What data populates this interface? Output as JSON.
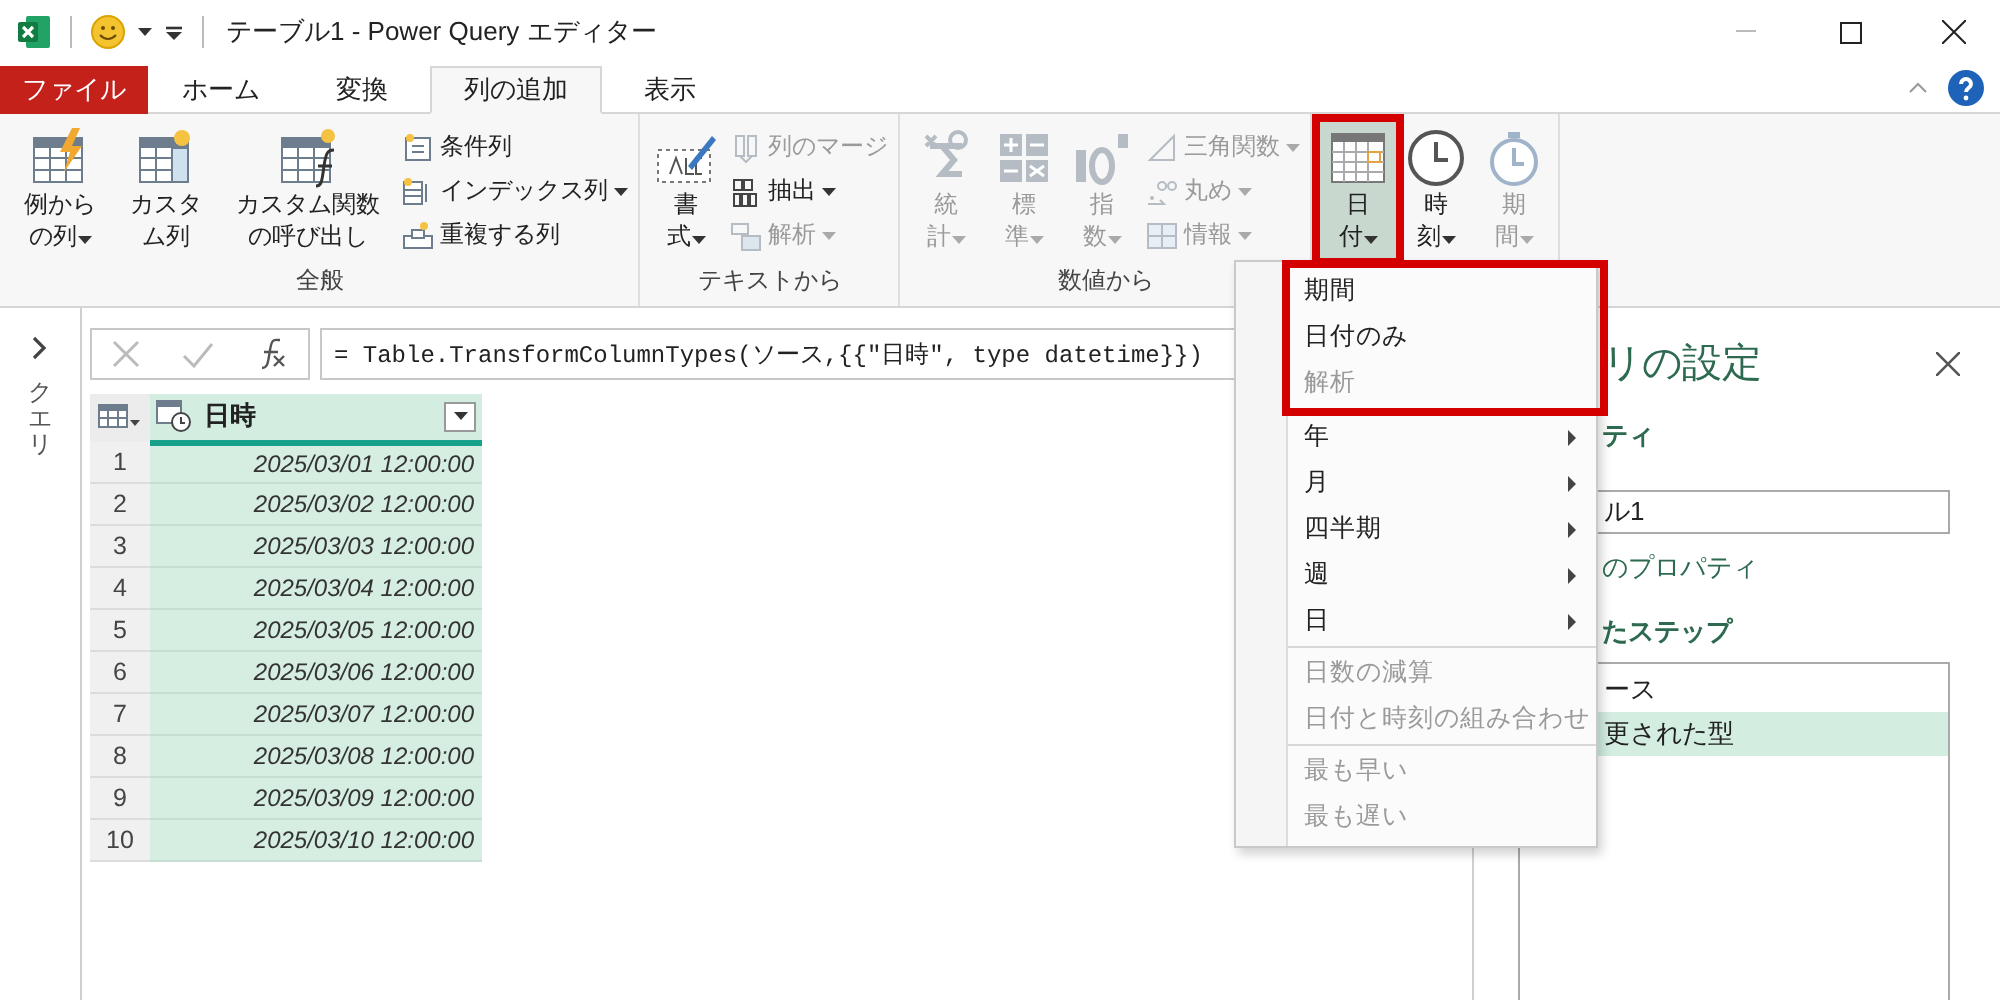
{
  "window": {
    "title": "テーブル1 - Power Query エディター"
  },
  "tabs": [
    {
      "label": "ファイル",
      "kind": "file",
      "selected": false
    },
    {
      "label": "ホーム",
      "kind": "tab",
      "selected": false
    },
    {
      "label": "変換",
      "kind": "tab",
      "selected": false
    },
    {
      "label": "列の追加",
      "kind": "tab",
      "selected": true
    },
    {
      "label": "表示",
      "kind": "tab",
      "selected": false
    }
  ],
  "ribbon": {
    "groups": [
      {
        "label": "全般",
        "large": [
          {
            "label": "例からの列",
            "dropdown": true,
            "disabled": false,
            "highlighted": false
          },
          {
            "label": "カスタム列",
            "dropdown": false,
            "disabled": false,
            "highlighted": false
          },
          {
            "label": "カスタム関数の呼び出し",
            "dropdown": false,
            "disabled": false,
            "highlighted": false
          }
        ],
        "small": [
          {
            "label": "条件列",
            "dropdown": false,
            "disabled": false
          },
          {
            "label": "インデックス列",
            "dropdown": true,
            "disabled": false
          },
          {
            "label": "重複する列",
            "dropdown": false,
            "disabled": false
          }
        ]
      },
      {
        "label": "テキストから",
        "large": [
          {
            "label": "書式",
            "dropdown": true,
            "disabled": false,
            "highlighted": false
          }
        ],
        "small": [
          {
            "label": "列のマージ",
            "dropdown": false,
            "disabled": true
          },
          {
            "label": "抽出",
            "dropdown": true,
            "disabled": false
          },
          {
            "label": "解析",
            "dropdown": true,
            "disabled": true
          }
        ]
      },
      {
        "label": "数値から",
        "large": [
          {
            "label": "統計",
            "dropdown": true,
            "disabled": true,
            "highlighted": false
          },
          {
            "label": "標準",
            "dropdown": true,
            "disabled": true,
            "highlighted": false
          },
          {
            "label": "指数",
            "dropdown": true,
            "disabled": true,
            "highlighted": false
          }
        ],
        "small": [
          {
            "label": "三角関数",
            "dropdown": true,
            "disabled": true
          },
          {
            "label": "丸め",
            "dropdown": true,
            "disabled": true
          },
          {
            "label": "情報",
            "dropdown": true,
            "disabled": true
          }
        ]
      },
      {
        "large": [
          {
            "label": "日付",
            "dropdown": true,
            "disabled": false,
            "highlighted": true
          },
          {
            "label": "時刻",
            "dropdown": true,
            "disabled": false,
            "highlighted": false
          },
          {
            "label": "期間",
            "dropdown": true,
            "disabled": true,
            "highlighted": false
          }
        ]
      }
    ]
  },
  "queries_pane": {
    "label": "クエリ"
  },
  "formula_bar": {
    "formula": "= Table.TransformColumnTypes(ソース,{{\"日時\", type datetime}})"
  },
  "table": {
    "columns": [
      {
        "label": "日時",
        "selected": true
      }
    ],
    "rows": [
      {
        "number": "1",
        "cells": [
          "2025/03/01 12:00:00"
        ]
      },
      {
        "number": "2",
        "cells": [
          "2025/03/02 12:00:00"
        ]
      },
      {
        "number": "3",
        "cells": [
          "2025/03/03 12:00:00"
        ]
      },
      {
        "number": "4",
        "cells": [
          "2025/03/04 12:00:00"
        ]
      },
      {
        "number": "5",
        "cells": [
          "2025/03/05 12:00:00"
        ]
      },
      {
        "number": "6",
        "cells": [
          "2025/03/06 12:00:00"
        ]
      },
      {
        "number": "7",
        "cells": [
          "2025/03/07 12:00:00"
        ]
      },
      {
        "number": "8",
        "cells": [
          "2025/03/08 12:00:00"
        ]
      },
      {
        "number": "9",
        "cells": [
          "2025/03/09 12:00:00"
        ]
      },
      {
        "number": "10",
        "cells": [
          "2025/03/10 12:00:00"
        ]
      }
    ]
  },
  "menu": {
    "sections": [
      {
        "highlighted": true,
        "items": [
          {
            "label": "期間",
            "disabled": false,
            "submenu": false
          },
          {
            "label": "日付のみ",
            "disabled": false,
            "submenu": false
          },
          {
            "label": "解析",
            "disabled": true,
            "submenu": false
          }
        ]
      },
      {
        "highlighted": false,
        "items": [
          {
            "label": "年",
            "disabled": false,
            "submenu": true
          },
          {
            "label": "月",
            "disabled": false,
            "submenu": true
          },
          {
            "label": "四半期",
            "disabled": false,
            "submenu": true
          },
          {
            "label": "週",
            "disabled": false,
            "submenu": true
          },
          {
            "label": "日",
            "disabled": false,
            "submenu": true
          }
        ]
      },
      {
        "highlighted": false,
        "items": [
          {
            "label": "日数の減算",
            "disabled": true,
            "submenu": false
          },
          {
            "label": "日付と時刻の組み合わせ",
            "disabled": true,
            "submenu": false
          }
        ]
      },
      {
        "highlighted": false,
        "items": [
          {
            "label": "最も早い",
            "disabled": true,
            "submenu": false
          },
          {
            "label": "最も遅い",
            "disabled": true,
            "submenu": false
          }
        ]
      }
    ]
  },
  "settings_pane": {
    "title": "リの設定",
    "properties_heading": "ティ",
    "name_value": "ル1",
    "all_properties_link": "のプロパティ",
    "steps_heading": "たステップ",
    "steps": [
      {
        "label": "ース",
        "selected": false
      },
      {
        "label": "更された型",
        "selected": true
      }
    ]
  }
}
